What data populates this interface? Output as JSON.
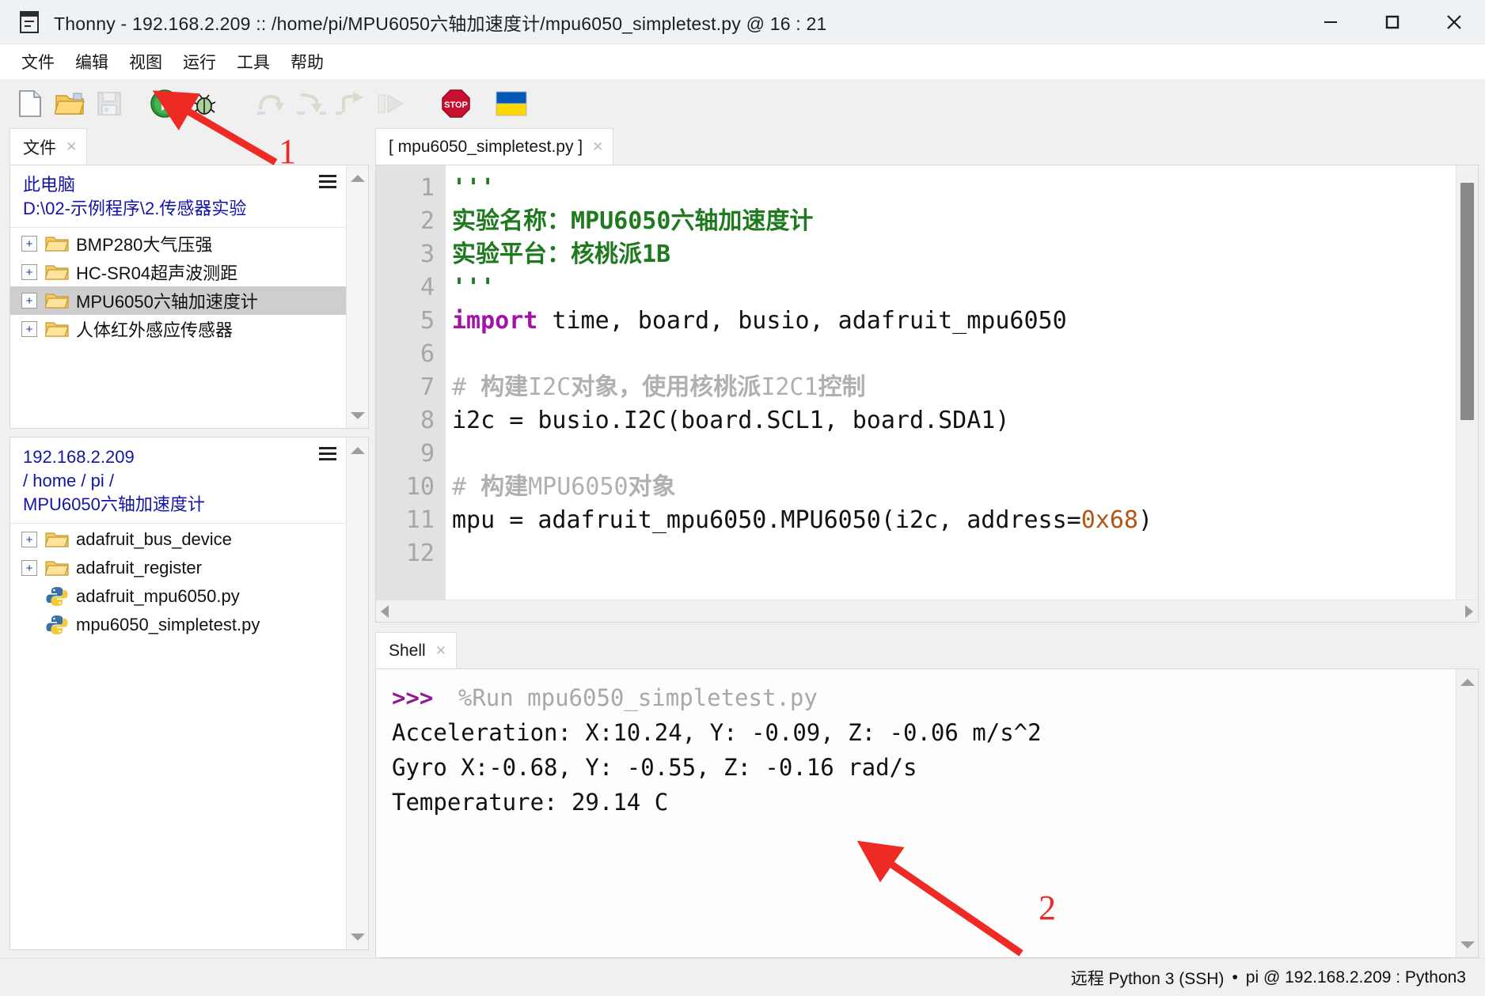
{
  "window": {
    "app_icon": "thonny-icon",
    "title": "Thonny  -  192.168.2.209 :: /home/pi/MPU6050六轴加速度计/mpu6050_simpletest.py  @  16 : 21",
    "minimize_label": "—",
    "maximize_label": "□",
    "close_label": "✕"
  },
  "menubar": {
    "items": [
      {
        "label": "文件",
        "name": "menu-file"
      },
      {
        "label": "编辑",
        "name": "menu-edit"
      },
      {
        "label": "视图",
        "name": "menu-view"
      },
      {
        "label": "运行",
        "name": "menu-run"
      },
      {
        "label": "工具",
        "name": "menu-tools"
      },
      {
        "label": "帮助",
        "name": "menu-help"
      }
    ]
  },
  "toolbar": {
    "buttons": [
      {
        "icon": "new-file-icon",
        "enabled": true
      },
      {
        "icon": "open-folder-icon",
        "enabled": true
      },
      {
        "icon": "save-icon",
        "enabled": false
      },
      {
        "icon": "run-icon",
        "enabled": true
      },
      {
        "icon": "debug-icon",
        "enabled": true
      },
      {
        "icon": "step-over-icon",
        "enabled": false
      },
      {
        "icon": "step-into-icon",
        "enabled": false
      },
      {
        "icon": "step-out-icon",
        "enabled": false
      },
      {
        "icon": "resume-icon",
        "enabled": false
      },
      {
        "icon": "stop-icon",
        "enabled": true
      },
      {
        "icon": "ukraine-flag-icon",
        "enabled": true
      }
    ]
  },
  "files_panel": {
    "tab_label": "文件",
    "tab_close": "✕",
    "local": {
      "header_lines": [
        "此电脑",
        "D:\\02-示例程序\\2.传感器实验"
      ],
      "menu_icon": "hamburger-icon",
      "rows": [
        {
          "label": "BMP280大气压强",
          "type": "folder",
          "expander": "+",
          "selected": false
        },
        {
          "label": "HC-SR04超声波测距",
          "type": "folder",
          "expander": "+",
          "selected": false
        },
        {
          "label": "MPU6050六轴加速度计",
          "type": "folder",
          "expander": "+",
          "selected": true
        },
        {
          "label": "人体红外感应传感器",
          "type": "folder",
          "expander": "+",
          "selected": false
        }
      ]
    },
    "remote": {
      "header_lines": [
        "192.168.2.209",
        "/ home / pi /",
        "MPU6050六轴加速度计"
      ],
      "menu_icon": "hamburger-icon",
      "rows": [
        {
          "label": "adafruit_bus_device",
          "type": "folder",
          "expander": "+",
          "selected": false
        },
        {
          "label": "adafruit_register",
          "type": "folder",
          "expander": "+",
          "selected": false
        },
        {
          "label": "adafruit_mpu6050.py",
          "type": "python",
          "expander": "",
          "selected": false
        },
        {
          "label": "mpu6050_simpletest.py",
          "type": "python",
          "expander": "",
          "selected": false
        }
      ]
    }
  },
  "editor": {
    "tab_label": "[ mpu6050_simpletest.py ]",
    "tab_close": "✕",
    "line_numbers": [
      "1",
      "2",
      "3",
      "4",
      "5",
      "6",
      "7",
      "8",
      "9",
      "10",
      "11",
      "12"
    ],
    "lines": [
      {
        "n": 1,
        "segments": [
          {
            "t": "'''",
            "c": "str"
          }
        ]
      },
      {
        "n": 2,
        "segments": [
          {
            "t": "实验名称：",
            "c": "str cjk"
          },
          {
            "t": "MPU6050",
            "c": "str"
          },
          {
            "t": "六轴加速度计",
            "c": "str cjk"
          }
        ]
      },
      {
        "n": 3,
        "segments": [
          {
            "t": "实验平台：核桃派",
            "c": "str cjk"
          },
          {
            "t": "1B",
            "c": "str"
          }
        ]
      },
      {
        "n": 4,
        "segments": [
          {
            "t": "'''",
            "c": "str"
          }
        ]
      },
      {
        "n": 5,
        "segments": [
          {
            "t": "import",
            "c": "kw"
          },
          {
            "t": " time, board, busio, adafruit_mpu6050",
            "c": "plain"
          }
        ]
      },
      {
        "n": 6,
        "segments": []
      },
      {
        "n": 7,
        "segments": [
          {
            "t": "# ",
            "c": "cmt"
          },
          {
            "t": "构建",
            "c": "cmt cjk"
          },
          {
            "t": "I2C",
            "c": "cmt"
          },
          {
            "t": "对象，使用核桃派",
            "c": "cmt cjk"
          },
          {
            "t": "I2C1",
            "c": "cmt"
          },
          {
            "t": "控制",
            "c": "cmt cjk"
          }
        ]
      },
      {
        "n": 8,
        "segments": [
          {
            "t": "i2c = busio.I2C(board.SCL1, board.SDA1)",
            "c": "plain"
          }
        ]
      },
      {
        "n": 9,
        "segments": []
      },
      {
        "n": 10,
        "segments": [
          {
            "t": "# ",
            "c": "cmt"
          },
          {
            "t": "构建",
            "c": "cmt cjk"
          },
          {
            "t": "MPU6050",
            "c": "cmt"
          },
          {
            "t": "对象",
            "c": "cmt cjk"
          }
        ]
      },
      {
        "n": 11,
        "segments": [
          {
            "t": "mpu = adafruit_mpu6050.MPU6050(i2c, address=",
            "c": "plain"
          },
          {
            "t": "0x68",
            "c": "num"
          },
          {
            "t": ")",
            "c": "plain"
          }
        ]
      },
      {
        "n": 12,
        "segments": []
      }
    ]
  },
  "shell": {
    "tab_label": "Shell",
    "tab_close": "✕",
    "prompt": ">>>",
    "command": "%Run mpu6050_simpletest.py",
    "output": [
      "Acceleration: X:10.24, Y: -0.09, Z: -0.06 m/s^2",
      "Gyro X:-0.68, Y: -0.55, Z: -0.16 rad/s",
      "Temperature: 29.14 C"
    ]
  },
  "statusbar": {
    "interpreter": "远程 Python 3 (SSH)",
    "separator": "•",
    "connection": "pi @ 192.168.2.209 : Python3"
  },
  "annotations": {
    "color": "#ee2a24",
    "markers": [
      {
        "label": "1",
        "target": "run-icon"
      },
      {
        "label": "2",
        "target": "shell-output"
      }
    ]
  }
}
